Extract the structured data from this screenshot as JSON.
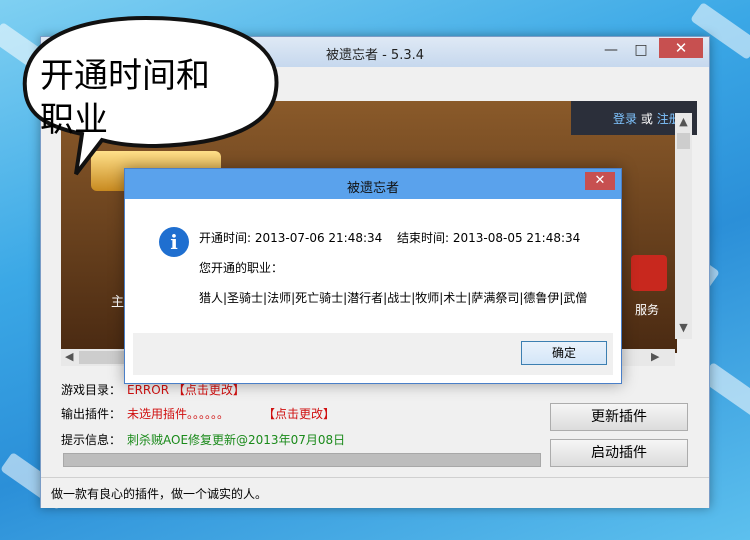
{
  "callout": {
    "line1": "开通时间和",
    "line2": "职业"
  },
  "window": {
    "title": "被遗忘者 - 5.3.4",
    "minimize": "—",
    "maximize": "□",
    "close": "✕"
  },
  "banner": {
    "login": "登录",
    "or": "或",
    "register": "注册",
    "service_label": "服务",
    "left_label": "主"
  },
  "rows": [
    {
      "label": "游戏目录：",
      "value": "ERROR 【点击更改】"
    },
    {
      "label": "输出插件：",
      "value": "未选用插件。。。。。。",
      "action": "【点击更改】"
    },
    {
      "label": "提示信息：",
      "value": "刺杀贼AOE修复更新@2013年07月08日"
    }
  ],
  "buttons": {
    "update": "更新插件",
    "launch": "启动插件"
  },
  "status": "做一款有良心的插件，做一个诚实的人。",
  "dialog": {
    "title": "被遗忘者",
    "close": "✕",
    "start_label": "开通时间: 2013-07-06 21:48:34",
    "end_label": "结束时间: 2013-08-05 21:48:34",
    "job_prompt": "您开通的职业：",
    "jobs": "猎人|圣骑士|法师|死亡骑士|潜行者|战士|牧师|术士|萨满祭司|德鲁伊|武僧",
    "ok": "确定"
  }
}
